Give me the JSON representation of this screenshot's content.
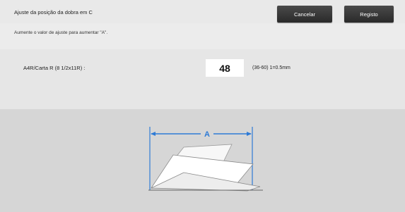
{
  "header": {
    "title": "Ajuste da posição da dobra em C",
    "cancel_label": "Cancelar",
    "save_label": "Registo"
  },
  "hint": "Aumente o valor de ajuste para aumentar \"A\".",
  "setting": {
    "label": "A4R/Carta R  (8 1/2x11R) :",
    "value": "48",
    "range": "(36-60) 1=0.5mm"
  },
  "illustration": {
    "dimension_label": "A",
    "accent_color": "#2e7bd6"
  }
}
